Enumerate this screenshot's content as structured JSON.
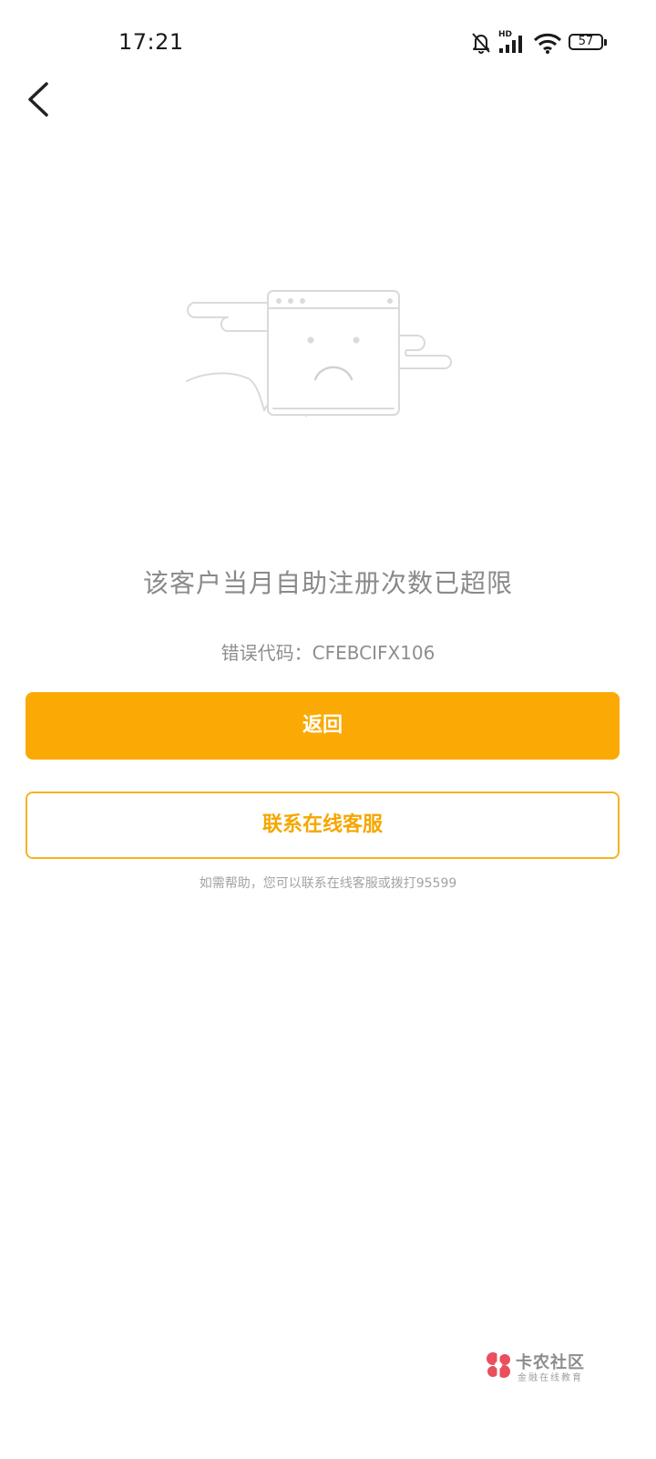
{
  "status_bar": {
    "time": "17:21",
    "network_label": "HD",
    "battery_level": "57",
    "icons": [
      "bell-muted-icon",
      "signal-icon",
      "wifi-icon",
      "battery-icon"
    ]
  },
  "nav": {
    "back_icon": "chevron-left-icon"
  },
  "illustration": {
    "icon": "sad-browser-window-illustration"
  },
  "error": {
    "message": "该客户当月自助注册次数已超限",
    "code_label": "错误代码：",
    "code_value": "CFEBCIFX106"
  },
  "actions": {
    "primary_label": "返回",
    "secondary_label": "联系在线客服"
  },
  "help": {
    "text": "如需帮助，您可以联系在线客服或拨打95599"
  },
  "watermark": {
    "title": "卡农社区",
    "subtitle": "金融在线教育"
  },
  "colors": {
    "accent": "#fbaa05",
    "accent_border": "#f5b224",
    "text_muted": "#8a8a8a"
  }
}
